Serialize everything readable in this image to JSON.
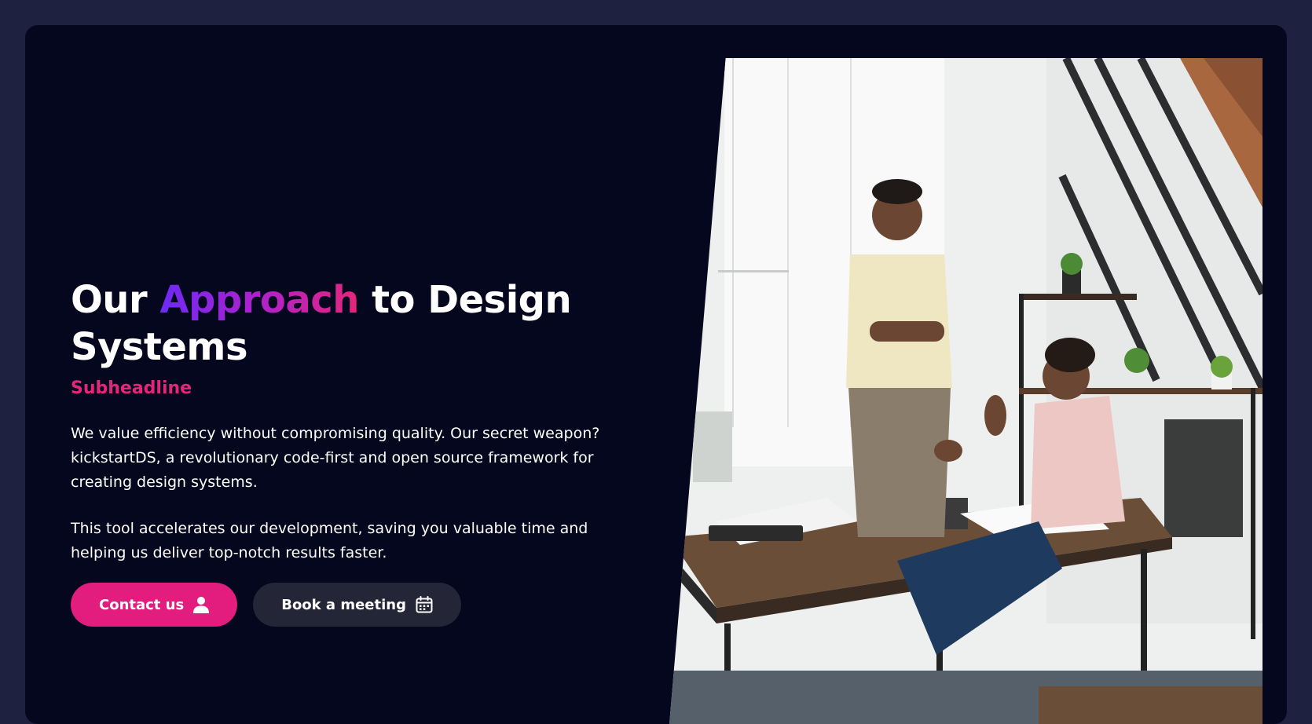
{
  "hero": {
    "headline_before": "Our ",
    "headline_highlight": "Approach",
    "headline_after": " to Design Systems",
    "subheadline": "Subheadline",
    "paragraph_1": "We value efficiency without compromising quality. Our secret weapon? kickstartDS, a revolutionary code-first and open source framework for creating design systems.",
    "paragraph_2": "This tool accelerates our development, saving you valuable time and helping us deliver top-notch results faster.",
    "buttons": [
      {
        "label": "Contact us",
        "icon": "person-icon"
      },
      {
        "label": "Book a meeting",
        "icon": "calendar-icon"
      }
    ]
  },
  "colors": {
    "page_background": "#1f2140",
    "card_background": "#05071e",
    "accent_pink": "#e31d7d",
    "accent_purple": "#6d2af5",
    "secondary_button": "#242638"
  }
}
